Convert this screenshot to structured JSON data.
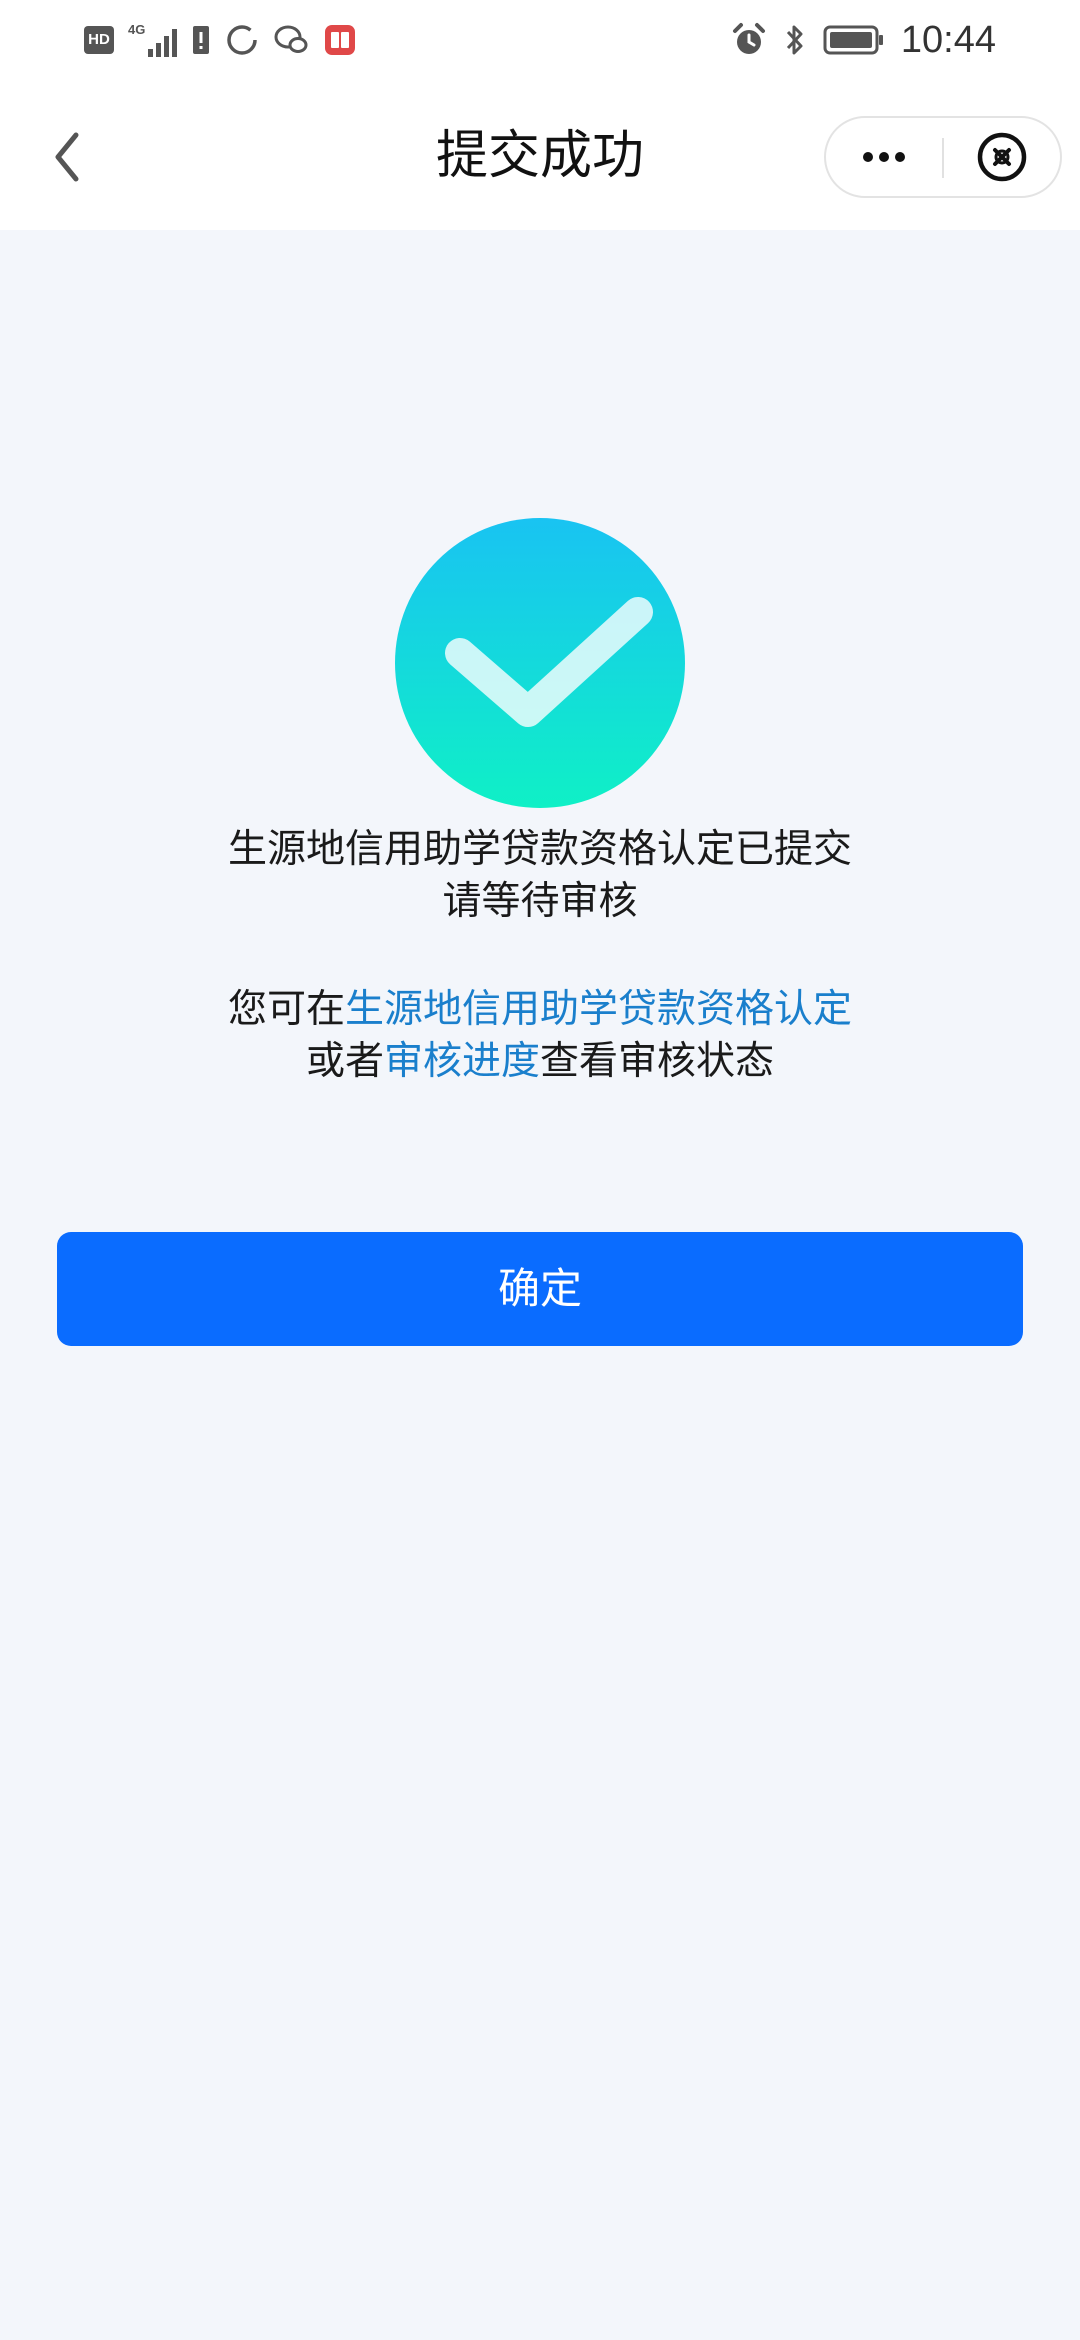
{
  "status_bar": {
    "hd_label": "HD",
    "network_label": "4G",
    "time": "10:44",
    "left_icons": [
      "hd-icon",
      "signal-icon",
      "sim-alert-icon",
      "circle-app-icon",
      "chat-icon",
      "book-app-icon"
    ],
    "right_icons": [
      "alarm-icon",
      "bluetooth-icon",
      "battery-icon"
    ]
  },
  "nav": {
    "title": "提交成功",
    "back_icon": "chevron-left-icon",
    "more_icon": "more-dots-icon",
    "close_icon": "close-circle-icon"
  },
  "result": {
    "icon": "check-circle-icon",
    "line1": "生源地信用助学贷款资格认定已提交",
    "line2": "请等待审核",
    "line3_prefix": "您可在",
    "line3_link": "生源地信用助学贷款资格认定",
    "line4_prefix": "或者",
    "line4_link": "审核进度",
    "line4_suffix": "查看审核状态"
  },
  "confirm_label": "确定",
  "colors": {
    "background": "#f3f6fb",
    "primary": "#0a6cff",
    "link": "#1a7fcc",
    "check_gradient_top": "#19c3f2",
    "check_gradient_bottom": "#0ff0c6"
  }
}
